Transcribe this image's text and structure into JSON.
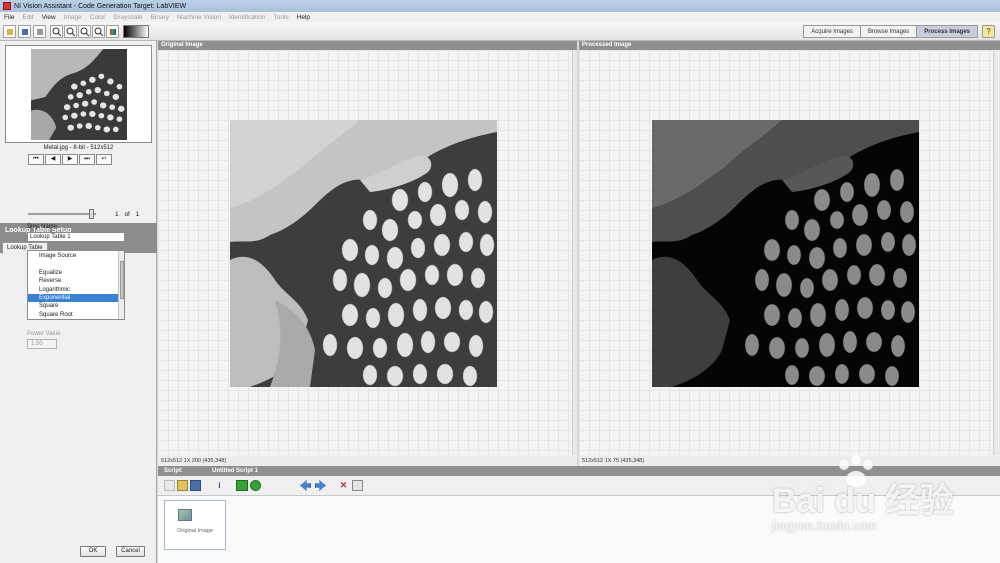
{
  "window": {
    "title": "NI Vision Assistant - Code Generation Target: LabVIEW"
  },
  "menu": [
    {
      "label": "File",
      "enabled": true
    },
    {
      "label": "Edit",
      "enabled": false
    },
    {
      "label": "View",
      "enabled": true
    },
    {
      "label": "Image",
      "enabled": false
    },
    {
      "label": "Color",
      "enabled": false
    },
    {
      "label": "Grayscale",
      "enabled": false
    },
    {
      "label": "Binary",
      "enabled": false
    },
    {
      "label": "Machine Vision",
      "enabled": false
    },
    {
      "label": "Identification",
      "enabled": false
    },
    {
      "label": "Tools",
      "enabled": false
    },
    {
      "label": "Help",
      "enabled": true
    }
  ],
  "mode_tabs": {
    "acquire": "Acquire Images",
    "browse": "Browse Images",
    "process": "Process Images",
    "active": "Process Images"
  },
  "left": {
    "thumbnail_caption": "Metal.jpg - 8-bit - 512x512",
    "nav": {
      "first": "⏮",
      "prev": "◀",
      "next": "▶",
      "last": "⏭",
      "back": "↩"
    },
    "page_index": "1",
    "page_of": "of",
    "page_total": "1",
    "setup_title": "Lookup Table Setup",
    "setup_tab": "Lookup Table",
    "step_name_label": "Step Name",
    "step_name_value": "Lookup Table 1",
    "list_items": [
      "Image Source",
      "",
      "Equalize",
      "Reverse",
      "Logarithmic",
      "Exponential",
      "Square",
      "Square Root"
    ],
    "list_selected": "Exponential",
    "power_value_label": "Power Value",
    "power_value": "1.50",
    "ok_label": "OK",
    "cancel_label": "Cancel"
  },
  "original_panel": {
    "title": "Original Image",
    "status": "512x512 1X 200    (435,348)"
  },
  "processed_panel": {
    "title": "Processed Image",
    "status": "512x512 1X 75    (435,348)"
  },
  "script": {
    "label": "Script:",
    "name": "Untitled Script 1",
    "step_label": "Original Image"
  },
  "watermark": {
    "main": "Bai du 经验",
    "sub": "jingyan.baidu.com"
  },
  "colors": {
    "selection": "#3a80d4",
    "panel_header": "#8f8f8f",
    "title_bar": "#bcd0e8"
  }
}
